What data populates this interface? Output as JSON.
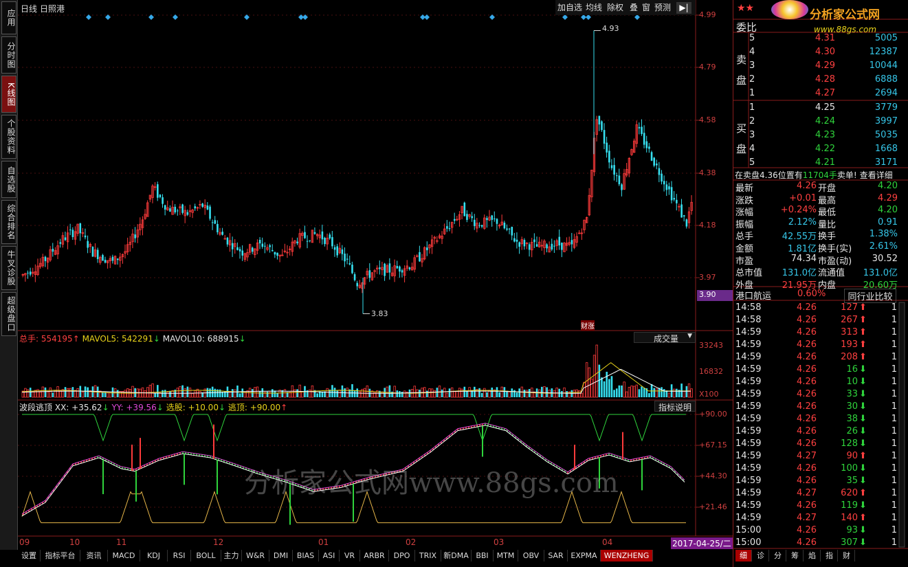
{
  "left_tabs": [
    "应用",
    "分时图",
    "K线图",
    "个股资料",
    "自选股",
    "综合排名",
    "牛叉诊股",
    "超级盘口"
  ],
  "chart_header": {
    "period": "日线",
    "stock": "日照港"
  },
  "toolbar": [
    "加自选",
    "均线",
    "除权",
    "叠",
    "窗",
    "预测"
  ],
  "price_axis": [
    "4.99",
    "4.79",
    "4.58",
    "4.38",
    "4.18",
    "3.97",
    "3.90"
  ],
  "price_annotations": {
    "high": "4.93",
    "low": "3.83",
    "badge": "财涨"
  },
  "volume_header": {
    "label": "总手:",
    "value": "554195",
    "mavol5_label": "MAVOL5:",
    "mavol5": "542291",
    "mavol10_label": "MAVOL10:",
    "mavol10": "688915",
    "select": "成交量"
  },
  "volume_axis": [
    "33243",
    "16832",
    "X100"
  ],
  "indicator_header": {
    "name": "波段逃顶",
    "xx": "XX: +35.62",
    "yy": "YY: +39.56",
    "xuangu": "选股: +10.00",
    "taoding": "逃顶: +90.00",
    "help": "指标说明"
  },
  "indicator_axis": [
    "+90.00",
    "+67.15",
    "+44.30",
    "+21.46"
  ],
  "month_axis": [
    "09",
    "10",
    "11",
    "12",
    "01",
    "02",
    "03",
    "04"
  ],
  "date_label": "2017-04-25/二",
  "watermark": "分析家公式网www.88gs.com",
  "bottom_tabs": [
    "设置",
    "指标平台",
    "资讯",
    "MACD",
    "KDJ",
    "RSI",
    "BOLL",
    "主力",
    "W&R",
    "DMI",
    "BIAS",
    "ASI",
    "VR",
    "ARBR",
    "DPO",
    "TRIX",
    "新DMA",
    "BBI",
    "MTM",
    "OBV",
    "SAR",
    "EXPMA",
    "WENZHENG"
  ],
  "logo": {
    "title": "分析家公式网",
    "url": "www.88gs.com"
  },
  "quote": {
    "weibi_label": "委比",
    "sell_label": "卖盘",
    "buy_label": "买盘",
    "sell": [
      {
        "lvl": "5",
        "price": "4.31",
        "vol": "5005"
      },
      {
        "lvl": "4",
        "price": "4.30",
        "vol": "12387"
      },
      {
        "lvl": "3",
        "price": "4.29",
        "vol": "10044"
      },
      {
        "lvl": "2",
        "price": "4.28",
        "vol": "6888"
      },
      {
        "lvl": "1",
        "price": "4.27",
        "vol": "2694"
      }
    ],
    "buy": [
      {
        "lvl": "1",
        "price": "4.25",
        "vol": "3779"
      },
      {
        "lvl": "2",
        "price": "4.24",
        "vol": "3997"
      },
      {
        "lvl": "3",
        "price": "4.23",
        "vol": "5035"
      },
      {
        "lvl": "4",
        "price": "4.22",
        "vol": "1668"
      },
      {
        "lvl": "5",
        "price": "4.21",
        "vol": "3171"
      }
    ],
    "notice": {
      "pre": "在卖盘4.36位置有",
      "vol": "11704手",
      "post": "卖单!",
      "link": "查看详细"
    },
    "stats": [
      [
        "最新",
        "4.26",
        "开盘",
        "4.20"
      ],
      [
        "涨跌",
        "+0.01",
        "最高",
        "4.29"
      ],
      [
        "涨幅",
        "+0.24%",
        "最低",
        "4.20"
      ],
      [
        "振幅",
        "2.12%",
        "量比",
        "0.91"
      ],
      [
        "总手",
        "42.55万",
        "换手",
        "1.38%"
      ],
      [
        "金额",
        "1.81亿",
        "换手(实)",
        "2.61%"
      ],
      [
        "市盈",
        "74.34",
        "市盈(动)",
        "30.52"
      ],
      [
        "总市值",
        "131.0亿",
        "流通值",
        "131.0亿"
      ],
      [
        "外盘",
        "21.95万",
        "内盘",
        "20.60万"
      ]
    ],
    "sector": {
      "name": "港口航运",
      "pct": "0.60%",
      "compare": "同行业比较"
    }
  },
  "ticks": [
    [
      "14:58",
      "4.26",
      "127",
      "up",
      "1"
    ],
    [
      "14:58",
      "4.26",
      "267",
      "up",
      "1"
    ],
    [
      "14:59",
      "4.26",
      "313",
      "up",
      "1"
    ],
    [
      "14:59",
      "4.26",
      "193",
      "up",
      "1"
    ],
    [
      "14:59",
      "4.26",
      "208",
      "up",
      "1"
    ],
    [
      "14:59",
      "4.26",
      "16",
      "down",
      "1"
    ],
    [
      "14:59",
      "4.26",
      "10",
      "down",
      "1"
    ],
    [
      "14:59",
      "4.26",
      "33",
      "down",
      "1"
    ],
    [
      "14:59",
      "4.26",
      "30",
      "down",
      "1"
    ],
    [
      "14:59",
      "4.26",
      "38",
      "down",
      "1"
    ],
    [
      "14:59",
      "4.26",
      "26",
      "down",
      "1"
    ],
    [
      "14:59",
      "4.26",
      "128",
      "down",
      "1"
    ],
    [
      "14:59",
      "4.27",
      "90",
      "up",
      "1"
    ],
    [
      "14:59",
      "4.26",
      "100",
      "down",
      "1"
    ],
    [
      "14:59",
      "4.26",
      "35",
      "down",
      "1"
    ],
    [
      "14:59",
      "4.27",
      "620",
      "up",
      "1"
    ],
    [
      "14:59",
      "4.26",
      "119",
      "down",
      "1"
    ],
    [
      "14:59",
      "4.27",
      "140",
      "up",
      "1"
    ],
    [
      "15:00",
      "4.26",
      "93",
      "down",
      "1"
    ],
    [
      "15:00",
      "4.26",
      "307",
      "down",
      "1"
    ]
  ],
  "right_bottom_tabs": [
    "细",
    "诊",
    "分",
    "筹",
    "焰",
    "指",
    "财"
  ],
  "colors": {
    "up": "#ff3b3b",
    "down": "#36e0f0",
    "frame": "#8a1c1c",
    "accent": "#7a1010"
  }
}
